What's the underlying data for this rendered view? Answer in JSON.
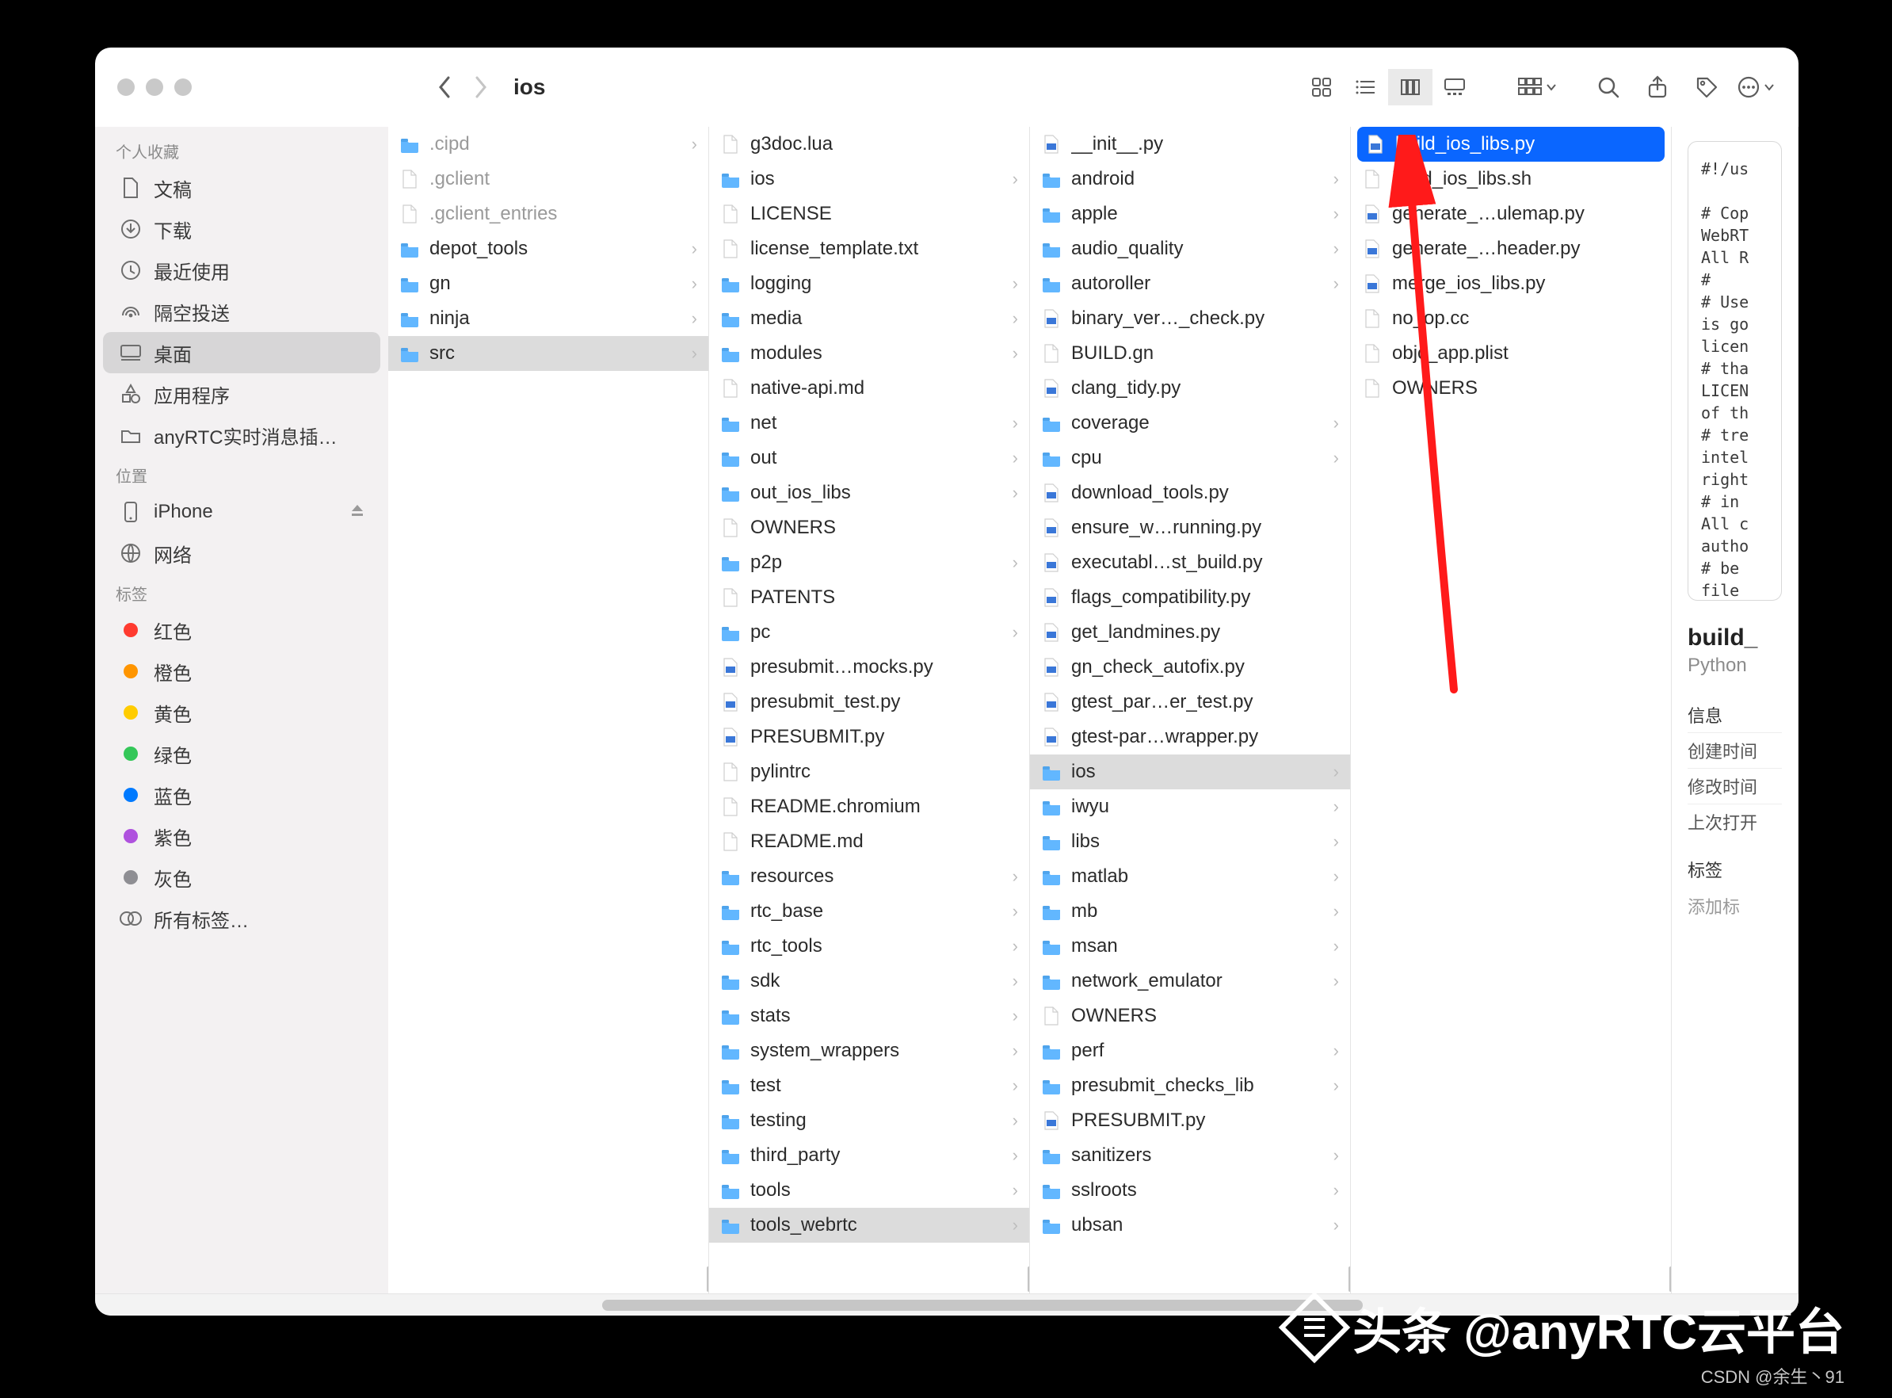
{
  "window": {
    "title": "ios"
  },
  "sidebar": {
    "sections": [
      {
        "title": "个人收藏",
        "items": [
          {
            "icon": "doc",
            "label": "文稿"
          },
          {
            "icon": "download",
            "label": "下载"
          },
          {
            "icon": "clock",
            "label": "最近使用"
          },
          {
            "icon": "airdrop",
            "label": "隔空投送"
          },
          {
            "icon": "desktop",
            "label": "桌面",
            "selected": true
          },
          {
            "icon": "app",
            "label": "应用程序"
          },
          {
            "icon": "folder",
            "label": "anyRTC实时消息插…"
          }
        ]
      },
      {
        "title": "位置",
        "items": [
          {
            "icon": "phone",
            "label": "iPhone",
            "eject": true
          },
          {
            "icon": "globe",
            "label": "网络"
          }
        ]
      },
      {
        "title": "标签",
        "items": [
          {
            "icon": "tag",
            "color": "#ff3b30",
            "label": "红色"
          },
          {
            "icon": "tag",
            "color": "#ff9500",
            "label": "橙色"
          },
          {
            "icon": "tag",
            "color": "#ffcc00",
            "label": "黄色"
          },
          {
            "icon": "tag",
            "color": "#34c759",
            "label": "绿色"
          },
          {
            "icon": "tag",
            "color": "#007aff",
            "label": "蓝色"
          },
          {
            "icon": "tag",
            "color": "#af52de",
            "label": "紫色"
          },
          {
            "icon": "tag",
            "color": "#8e8e93",
            "label": "灰色"
          },
          {
            "icon": "alltags",
            "label": "所有标签…"
          }
        ]
      }
    ]
  },
  "columns": [
    {
      "items": [
        {
          "t": "folder",
          "n": ".cipd",
          "dim": true,
          "chev": true
        },
        {
          "t": "file",
          "n": ".gclient",
          "dim": true
        },
        {
          "t": "file",
          "n": ".gclient_entries",
          "dim": true
        },
        {
          "t": "folder",
          "n": "depot_tools",
          "chev": true
        },
        {
          "t": "folder",
          "n": "gn",
          "chev": true
        },
        {
          "t": "folder",
          "n": "ninja",
          "chev": true
        },
        {
          "t": "folder",
          "n": "src",
          "chev": true,
          "sel": "grey"
        }
      ]
    },
    {
      "scroll": true,
      "items": [
        {
          "t": "file",
          "n": "g3doc.lua"
        },
        {
          "t": "folder",
          "n": "ios",
          "chev": true
        },
        {
          "t": "file",
          "n": "LICENSE"
        },
        {
          "t": "file",
          "n": "license_template.txt"
        },
        {
          "t": "folder",
          "n": "logging",
          "chev": true
        },
        {
          "t": "folder",
          "n": "media",
          "chev": true
        },
        {
          "t": "folder",
          "n": "modules",
          "chev": true
        },
        {
          "t": "file",
          "n": "native-api.md"
        },
        {
          "t": "folder",
          "n": "net",
          "chev": true
        },
        {
          "t": "folder",
          "n": "out",
          "chev": true
        },
        {
          "t": "folder",
          "n": "out_ios_libs",
          "chev": true
        },
        {
          "t": "file",
          "n": "OWNERS"
        },
        {
          "t": "folder",
          "n": "p2p",
          "chev": true
        },
        {
          "t": "file",
          "n": "PATENTS"
        },
        {
          "t": "folder",
          "n": "pc",
          "chev": true
        },
        {
          "t": "py",
          "n": "presubmit…mocks.py"
        },
        {
          "t": "py",
          "n": "presubmit_test.py"
        },
        {
          "t": "py",
          "n": "PRESUBMIT.py"
        },
        {
          "t": "file",
          "n": "pylintrc"
        },
        {
          "t": "file",
          "n": "README.chromium"
        },
        {
          "t": "file",
          "n": "README.md"
        },
        {
          "t": "folder",
          "n": "resources",
          "chev": true
        },
        {
          "t": "folder",
          "n": "rtc_base",
          "chev": true
        },
        {
          "t": "folder",
          "n": "rtc_tools",
          "chev": true
        },
        {
          "t": "folder",
          "n": "sdk",
          "chev": true
        },
        {
          "t": "folder",
          "n": "stats",
          "chev": true
        },
        {
          "t": "folder",
          "n": "system_wrappers",
          "chev": true
        },
        {
          "t": "folder",
          "n": "test",
          "chev": true
        },
        {
          "t": "folder",
          "n": "testing",
          "chev": true
        },
        {
          "t": "folder",
          "n": "third_party",
          "chev": true
        },
        {
          "t": "folder",
          "n": "tools",
          "chev": true
        },
        {
          "t": "folder",
          "n": "tools_webrtc",
          "chev": true,
          "sel": "grey"
        }
      ]
    },
    {
      "items": [
        {
          "t": "py",
          "n": "__init__.py"
        },
        {
          "t": "folder",
          "n": "android",
          "chev": true
        },
        {
          "t": "folder",
          "n": "apple",
          "chev": true
        },
        {
          "t": "folder",
          "n": "audio_quality",
          "chev": true
        },
        {
          "t": "folder",
          "n": "autoroller",
          "chev": true
        },
        {
          "t": "py",
          "n": "binary_ver…_check.py"
        },
        {
          "t": "file",
          "n": "BUILD.gn"
        },
        {
          "t": "py",
          "n": "clang_tidy.py"
        },
        {
          "t": "folder",
          "n": "coverage",
          "chev": true
        },
        {
          "t": "folder",
          "n": "cpu",
          "chev": true
        },
        {
          "t": "py",
          "n": "download_tools.py"
        },
        {
          "t": "py",
          "n": "ensure_w…running.py"
        },
        {
          "t": "py",
          "n": "executabl…st_build.py"
        },
        {
          "t": "py",
          "n": "flags_compatibility.py"
        },
        {
          "t": "py",
          "n": "get_landmines.py"
        },
        {
          "t": "py",
          "n": "gn_check_autofix.py"
        },
        {
          "t": "py",
          "n": "gtest_par…er_test.py"
        },
        {
          "t": "py",
          "n": "gtest-par…wrapper.py"
        },
        {
          "t": "folder",
          "n": "ios",
          "chev": true,
          "sel": "grey"
        },
        {
          "t": "folder",
          "n": "iwyu",
          "chev": true
        },
        {
          "t": "folder",
          "n": "libs",
          "chev": true
        },
        {
          "t": "folder",
          "n": "matlab",
          "chev": true
        },
        {
          "t": "folder",
          "n": "mb",
          "chev": true
        },
        {
          "t": "folder",
          "n": "msan",
          "chev": true
        },
        {
          "t": "folder",
          "n": "network_emulator",
          "chev": true
        },
        {
          "t": "file",
          "n": "OWNERS"
        },
        {
          "t": "folder",
          "n": "perf",
          "chev": true
        },
        {
          "t": "folder",
          "n": "presubmit_checks_lib",
          "chev": true
        },
        {
          "t": "py",
          "n": "PRESUBMIT.py"
        },
        {
          "t": "folder",
          "n": "sanitizers",
          "chev": true
        },
        {
          "t": "folder",
          "n": "sslroots",
          "chev": true
        },
        {
          "t": "folder",
          "n": "ubsan",
          "chev": true
        }
      ]
    },
    {
      "items": [
        {
          "t": "py",
          "n": "build_ios_libs.py",
          "sel": "blue"
        },
        {
          "t": "file",
          "n": "build_ios_libs.sh"
        },
        {
          "t": "py",
          "n": "generate_…ulemap.py"
        },
        {
          "t": "py",
          "n": "generate_…header.py"
        },
        {
          "t": "py",
          "n": "merge_ios_libs.py"
        },
        {
          "t": "file",
          "n": "no_op.cc"
        },
        {
          "t": "file",
          "n": "objc_app.plist"
        },
        {
          "t": "file",
          "n": "OWNERS"
        }
      ]
    }
  ],
  "preview": {
    "code": "#!/us\n\n# Cop\nWebRT\nAll R\n#\n# Use\nis go\nlicen\n# tha\nLICEN\nof th\n# tre\nintel\nright\n# in\nAll c\nautho\n# be\nfile\nsourc",
    "filename": "build_",
    "filetype": "Python",
    "section_info": "信息",
    "rows": [
      {
        "k": "创建时间",
        "v": ""
      },
      {
        "k": "修改时间",
        "v": ""
      },
      {
        "k": "上次打开",
        "v": ""
      }
    ],
    "section_tags": "标签",
    "add_tag": "添加标"
  },
  "toolbar_icons": {
    "group_label": ""
  },
  "watermark1_prefix": "头条",
  "watermark1_handle": "@anyRTC云平台",
  "watermark2": "CSDN @余生丶91"
}
